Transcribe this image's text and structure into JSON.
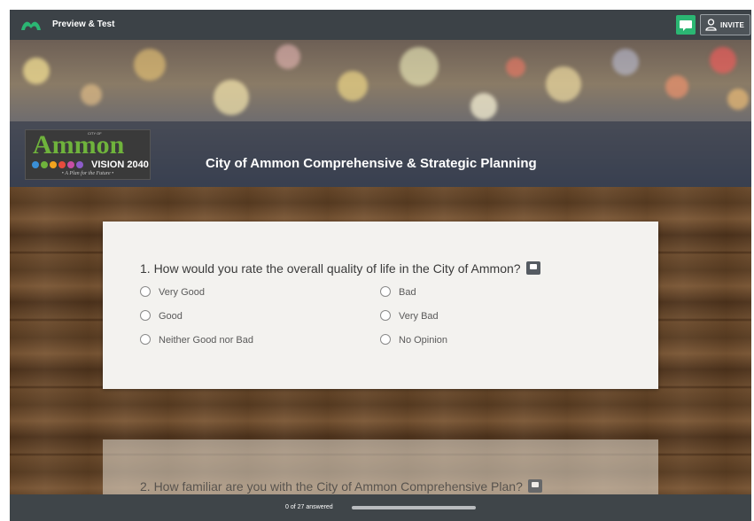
{
  "topbar": {
    "title": "Preview & Test",
    "invite_label": "INVITE",
    "logo_icon": "survey-monkey-logo-icon",
    "chat_icon": "chat-bubble-icon",
    "user_icon": "user-icon",
    "accent": "#2bb673"
  },
  "hero": {
    "logo_top": "CITY OF",
    "logo_word": "Ammon",
    "logo_vision": "VISION 2040",
    "logo_tagline": "• A Plan for the Future •",
    "survey_title": "City of Ammon Comprehensive & Strategic Planning"
  },
  "questions": [
    {
      "text": "1. How would you rate the overall quality of life in the City of Ammon?",
      "options": [
        "Very Good",
        "Good",
        "Neither Good nor Bad",
        "Bad",
        "Very Bad",
        "No Opinion"
      ]
    },
    {
      "text": "2. How familiar are you with the City of Ammon Comprehensive Plan?"
    }
  ],
  "footer": {
    "progress_text": "0 of 27 answered",
    "progress_fraction": 0.0
  }
}
